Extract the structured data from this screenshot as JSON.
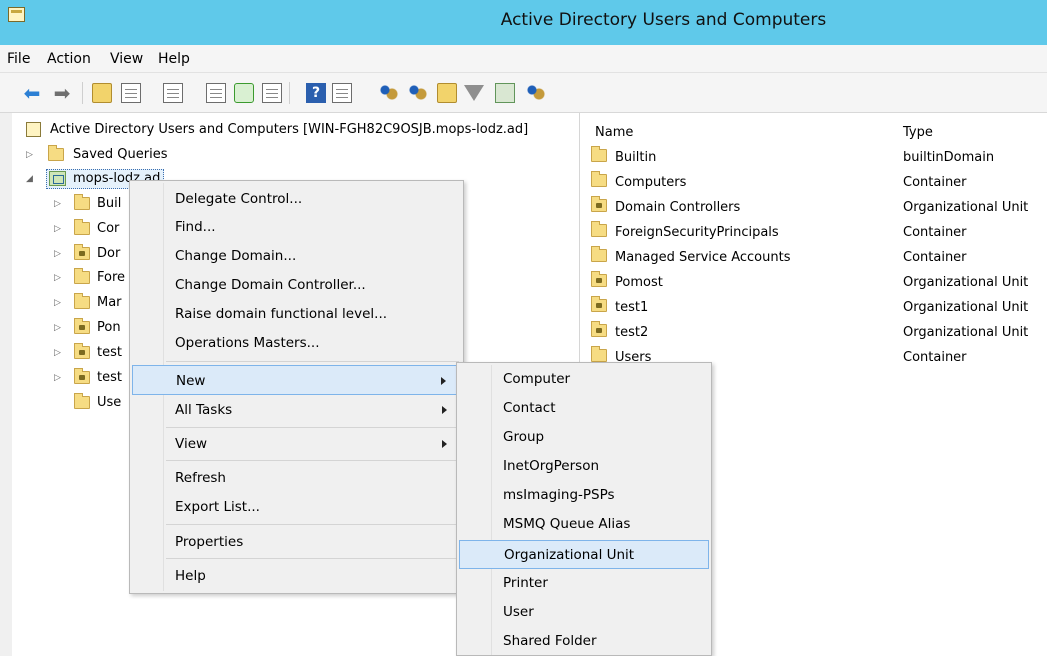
{
  "window": {
    "title": "Active Directory Users and Computers"
  },
  "menubar": [
    "File",
    "Action",
    "View",
    "Help"
  ],
  "toolbar": {
    "icons": [
      "back-arrow-icon",
      "forward-arrow-icon",
      "up-folder-icon",
      "show-hide-console-tree-icon",
      "clipboard-icon",
      "properties-icon",
      "refresh-icon",
      "export-list-icon",
      "help-icon",
      "show-action-pane-icon",
      "new-user-icon",
      "new-group-icon",
      "new-ou-icon",
      "filter-icon",
      "find-icon",
      "move-users-icon"
    ]
  },
  "tree": {
    "root": "Active Directory Users and Computers [WIN-FGH82C9OSJB.mops-lodz.ad]",
    "saved_queries": "Saved Queries",
    "domain": "mops-lodz.ad",
    "children": [
      "Buil",
      "Cor",
      "Dor",
      "Fore",
      "Mar",
      "Pon",
      "test",
      "test",
      "Use"
    ]
  },
  "list": {
    "columns": {
      "name": "Name",
      "type": "Type"
    },
    "rows": [
      {
        "name": "Builtin",
        "type": "builtinDomain",
        "icon": "folder"
      },
      {
        "name": "Computers",
        "type": "Container",
        "icon": "folder"
      },
      {
        "name": "Domain Controllers",
        "type": "Organizational Unit",
        "icon": "ou"
      },
      {
        "name": "ForeignSecurityPrincipals",
        "type": "Container",
        "icon": "folder"
      },
      {
        "name": "Managed Service Accounts",
        "type": "Container",
        "icon": "folder"
      },
      {
        "name": "Pomost",
        "type": "Organizational Unit",
        "icon": "ou"
      },
      {
        "name": "test1",
        "type": "Organizational Unit",
        "icon": "ou"
      },
      {
        "name": "test2",
        "type": "Organizational Unit",
        "icon": "ou"
      },
      {
        "name": "Users",
        "type": "Container",
        "icon": "folder"
      }
    ]
  },
  "context_menu": {
    "items": [
      "Delegate Control...",
      "Find...",
      "Change Domain...",
      "Change Domain Controller...",
      "Raise domain functional level...",
      "Operations Masters...",
      "New",
      "All Tasks",
      "View",
      "Refresh",
      "Export List...",
      "Properties",
      "Help"
    ],
    "highlighted": "New"
  },
  "new_submenu": {
    "items": [
      "Computer",
      "Contact",
      "Group",
      "InetOrgPerson",
      "msImaging-PSPs",
      "MSMQ Queue Alias",
      "Organizational Unit",
      "Printer",
      "User",
      "Shared Folder"
    ],
    "highlighted": "Organizational Unit"
  }
}
